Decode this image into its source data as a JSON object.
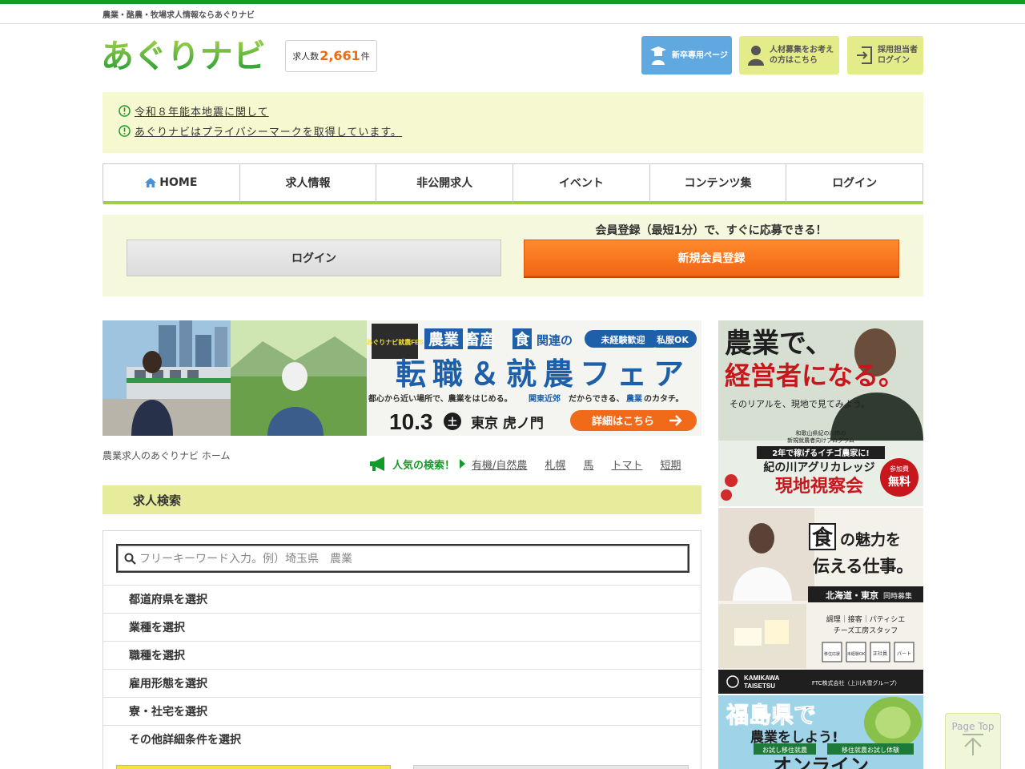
{
  "header": {
    "tagline": "農業・酪農・牧場求人情報ならあぐりナビ",
    "logo_text": "あぐりナビ",
    "job_count": {
      "prefix": "求人数",
      "value": "2,661",
      "suffix": "件"
    },
    "buttons": {
      "new_grad": "新卒専用ページ",
      "recruit_line1": "人材募集をお考え",
      "recruit_line2": "の方はこちら",
      "staff_line1": "採用担当者",
      "staff_line2": "ログイン"
    }
  },
  "notices": [
    "令和８年能本地震に関して",
    "あぐりナビはプライバシーマークを取得しています。"
  ],
  "nav": [
    {
      "label": "HOME"
    },
    {
      "label": "求人情報"
    },
    {
      "label": "非公開求人"
    },
    {
      "label": "イベント"
    },
    {
      "label": "コンテンツ集"
    },
    {
      "label": "ログイン"
    }
  ],
  "member": {
    "lead": "会員登録（最短1分）で、すぐに応募できる！",
    "login": "ログイン",
    "register": "新規会員登録"
  },
  "main_banner": {
    "fair_logo": "あぐりナビ就農FES",
    "headline_tags": [
      "農業",
      "畜産",
      "食"
    ],
    "headline_suffix": "関連の",
    "badge1": "未経験歓迎",
    "badge2": "私服OK",
    "title": "転職＆就農フェア",
    "subtitle_a": "都心から近い場所で、農業をはじめる。",
    "subtitle_b": "関東近郊",
    "subtitle_c": "だからできる、",
    "subtitle_d": "農業",
    "subtitle_e": "のカタチ。",
    "date": "10.3",
    "weekday": "土",
    "place": "東京 虎ノ門",
    "cta": "詳細はこちら"
  },
  "breadcrumb": "農業求人のあぐりナビ ホーム",
  "popular": {
    "label": "人気の検索！",
    "links": [
      "有機/自然農",
      "札幌",
      "馬",
      "トマト",
      "短期"
    ]
  },
  "search": {
    "title": "求人検索",
    "placeholder": "フリーキーワード入力。例）埼玉県　農業",
    "conditions": [
      "都道府県を選択",
      "業種を選択",
      "職種を選択",
      "雇用形態を選択",
      "寮・社宅を選択",
      "その他詳細条件を選択"
    ]
  },
  "side_banners": {
    "b1": {
      "headline1": "農業で、",
      "headline2": "経営者になる。",
      "sub": "そのリアルを、現地で見てみよう。",
      "small1": "和歌山県紀の川市の",
      "small2": "新規就農者向けプログラム",
      "strip": "2年で稼げるイチゴ農家に!",
      "name": "紀の川アグリカレッジ",
      "event": "現地視察会",
      "badge_top": "参加費",
      "badge_bottom": "無料"
    },
    "b2": {
      "headline_kanji": "食",
      "headline_rest1": "の魅力を",
      "headline2": "伝える仕事。",
      "location": "北海道・東京",
      "location_tail": "同時募集",
      "jobs1": "調理｜接客｜パティシエ",
      "jobs2": "チーズ工房スタッフ",
      "tags": [
        "移住応援",
        "未経験OK",
        "正社員",
        "パート"
      ],
      "brand1": "KAMIKAWA",
      "brand2": "TAISETSU",
      "company": "FTC株式会社（上川大雪グループ）"
    },
    "b3": {
      "headline1": "福島県で",
      "headline2": "農業をしよう!",
      "strip_a": "お試し移住就農",
      "strip_b": "移住就農お試し体験",
      "bottom": "オンライン"
    }
  },
  "page_top": "Page Top",
  "colors": {
    "brand_green": "#139b2a",
    "nav_underline": "#9ccf42",
    "accent_orange": "#f16515",
    "count_orange": "#ea6b16",
    "notice_bg": "#f6f8cf"
  }
}
